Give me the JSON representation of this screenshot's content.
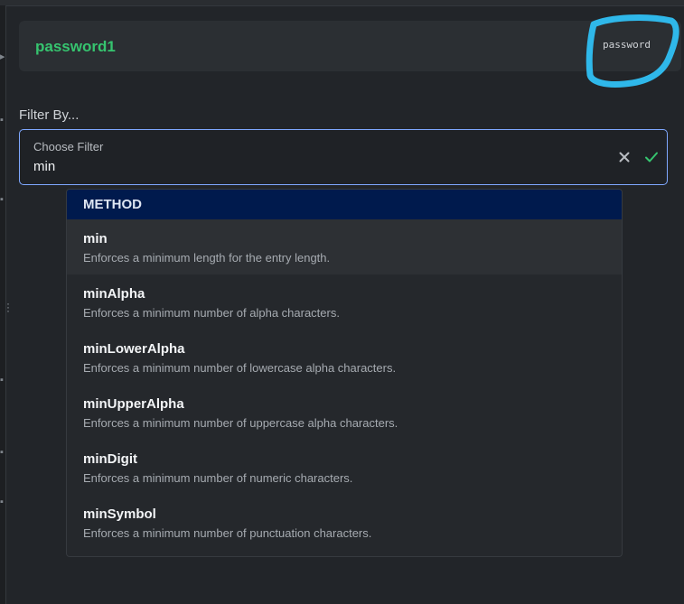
{
  "entry": {
    "name": "password1",
    "type": "password"
  },
  "filter": {
    "label": "Filter By...",
    "placeholder": "Choose Filter",
    "value": "min"
  },
  "dropdown": {
    "group": "METHOD",
    "options": [
      {
        "name": "min",
        "description": "Enforces a minimum length for the entry length."
      },
      {
        "name": "minAlpha",
        "description": "Enforces a minimum number of alpha characters."
      },
      {
        "name": "minLowerAlpha",
        "description": "Enforces a minimum number of lowercase alpha characters."
      },
      {
        "name": "minUpperAlpha",
        "description": "Enforces a minimum number of uppercase alpha characters."
      },
      {
        "name": "minDigit",
        "description": "Enforces a minimum number of numeric characters."
      },
      {
        "name": "minSymbol",
        "description": "Enforces a minimum number of punctuation characters."
      }
    ]
  },
  "colors": {
    "accent_green": "#36c46f",
    "focus_border": "#7fa8ff",
    "group_header_bg": "#001a4d",
    "annotation_stroke": "#2fb8ea"
  }
}
